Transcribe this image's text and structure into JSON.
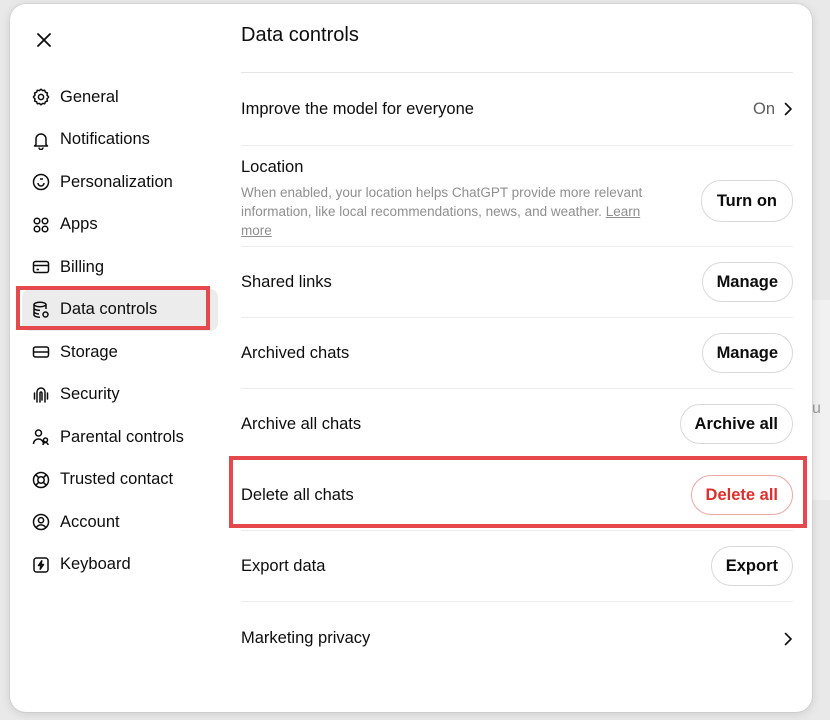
{
  "background": {
    "fragment": "u"
  },
  "modal": {
    "close_label": "Close"
  },
  "sidebar": {
    "items": [
      {
        "label": "General",
        "icon": "gear-icon"
      },
      {
        "label": "Notifications",
        "icon": "bell-icon"
      },
      {
        "label": "Personalization",
        "icon": "personalization-icon"
      },
      {
        "label": "Apps",
        "icon": "apps-icon"
      },
      {
        "label": "Billing",
        "icon": "card-icon"
      },
      {
        "label": "Data controls",
        "icon": "database-gear-icon",
        "active": true
      },
      {
        "label": "Storage",
        "icon": "storage-icon"
      },
      {
        "label": "Security",
        "icon": "security-icon"
      },
      {
        "label": "Parental controls",
        "icon": "parental-icon"
      },
      {
        "label": "Trusted contact",
        "icon": "lifebuoy-icon"
      },
      {
        "label": "Account",
        "icon": "account-icon"
      },
      {
        "label": "Keyboard",
        "icon": "keyboard-icon"
      }
    ]
  },
  "panel": {
    "title": "Data controls",
    "improve": {
      "label": "Improve the model for everyone",
      "value": "On"
    },
    "location": {
      "label": "Location",
      "description": "When enabled, your location helps ChatGPT provide more relevant information, like local recommendations, news, and weather.",
      "link": "Learn more",
      "button": "Turn on"
    },
    "shared_links": {
      "label": "Shared links",
      "button": "Manage"
    },
    "archived_chats": {
      "label": "Archived chats",
      "button": "Manage"
    },
    "archive_all": {
      "label": "Archive all chats",
      "button": "Archive all"
    },
    "delete_all": {
      "label": "Delete all chats",
      "button": "Delete all"
    },
    "export": {
      "label": "Export data",
      "button": "Export"
    },
    "marketing": {
      "label": "Marketing privacy"
    }
  },
  "colors": {
    "highlight": "#e5484d",
    "danger": "#e02e2a",
    "active_bg": "#ececec"
  }
}
